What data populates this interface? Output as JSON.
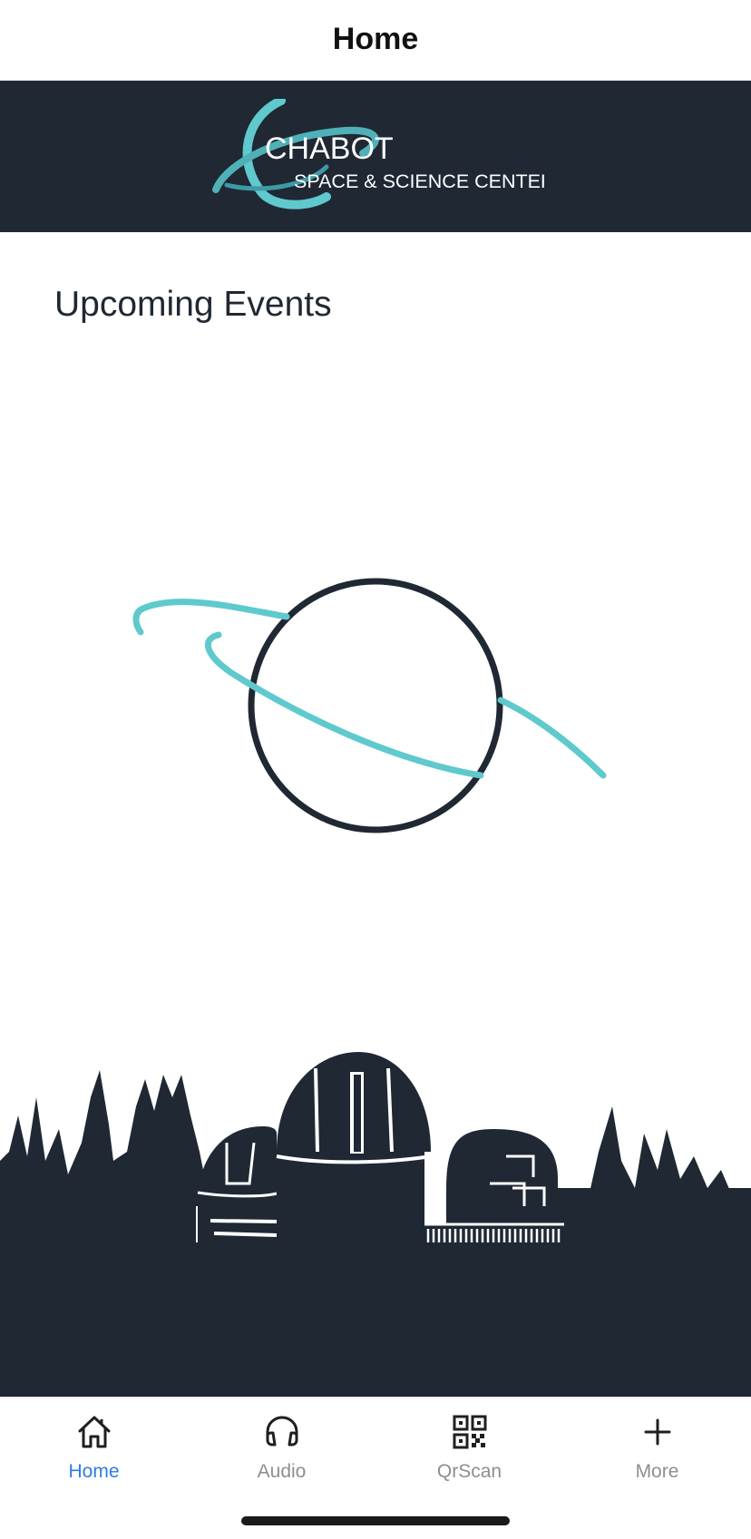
{
  "header": {
    "title": "Home"
  },
  "brand": {
    "name_line1": "CHABOT",
    "name_line2": "SPACE & SCIENCE CENTER",
    "background_color": "#1f2833",
    "accent_color": "#5fc9cd"
  },
  "main": {
    "section_title": "Upcoming Events",
    "loading_indicator": "planet-icon"
  },
  "tabs": [
    {
      "label": "Home",
      "icon": "home-icon",
      "active": true
    },
    {
      "label": "Audio",
      "icon": "headphones-icon",
      "active": false
    },
    {
      "label": "QrScan",
      "icon": "qr-code-icon",
      "active": false
    },
    {
      "label": "More",
      "icon": "plus-icon",
      "active": false
    }
  ],
  "colors": {
    "active_tab": "#2f7de1",
    "inactive_tab": "#8e8e93"
  }
}
